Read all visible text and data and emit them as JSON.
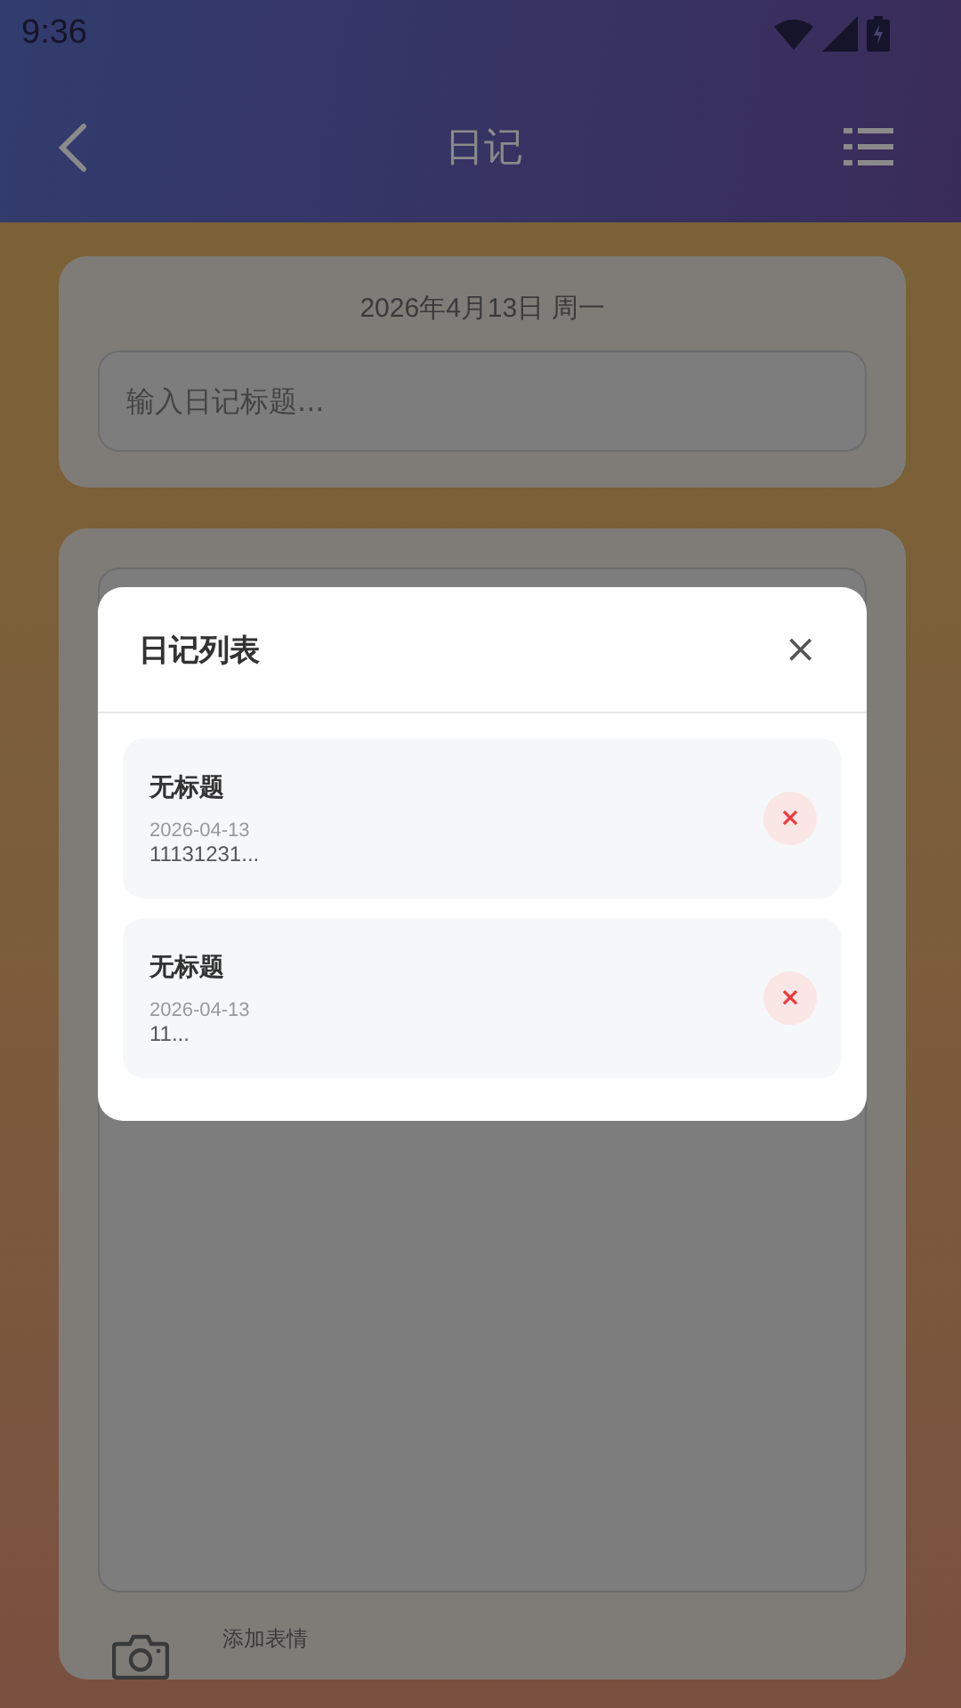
{
  "status_bar": {
    "time": "9:36"
  },
  "header": {
    "title": "日记"
  },
  "entry_form": {
    "date": "2026年4月13日 周一",
    "title_placeholder": "输入日记标题..."
  },
  "editor": {
    "emoji_label": "添加表情"
  },
  "dialog": {
    "title": "日记列表",
    "close": "×",
    "entries": [
      {
        "title": "无标题",
        "date": "2026-04-13",
        "preview": "11131231...",
        "delete": "×"
      },
      {
        "title": "无标题",
        "date": "2026-04-13",
        "preview": "11...",
        "delete": "×"
      }
    ]
  }
}
